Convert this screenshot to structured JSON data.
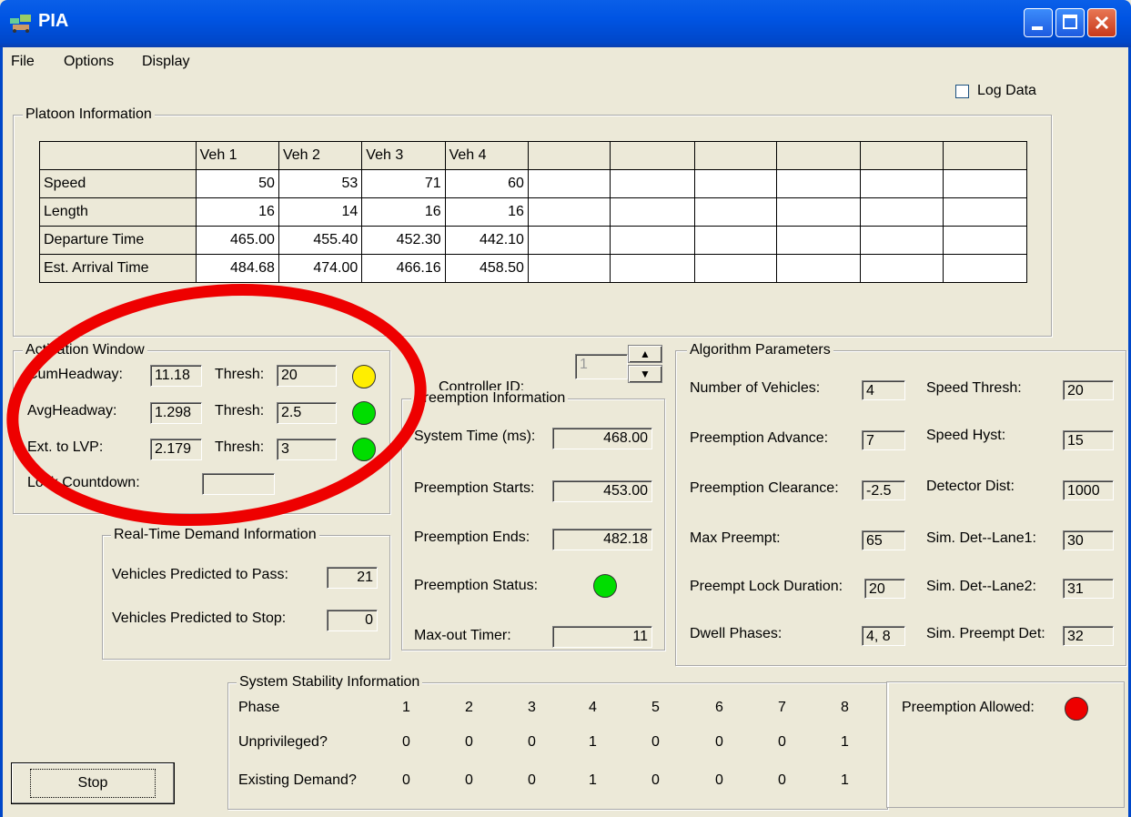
{
  "window": {
    "title": "PIA"
  },
  "menu": [
    "File",
    "Options",
    "Display"
  ],
  "log_data": {
    "label": "Log Data",
    "checked": false
  },
  "platoon": {
    "legend": "Platoon Information",
    "columns": [
      "",
      "Veh 1",
      "Veh 2",
      "Veh 3",
      "Veh 4",
      "",
      "",
      "",
      "",
      "",
      ""
    ],
    "rows": [
      {
        "label": "Speed",
        "values": [
          "50",
          "53",
          "71",
          "60"
        ]
      },
      {
        "label": "Length",
        "values": [
          "16",
          "14",
          "16",
          "16"
        ]
      },
      {
        "label": "Departure Time",
        "values": [
          "465.00",
          "455.40",
          "452.30",
          "442.10"
        ]
      },
      {
        "label": "Est. Arrival Time",
        "values": [
          "484.68",
          "474.00",
          "466.16",
          "458.50"
        ]
      }
    ]
  },
  "activation": {
    "legend": "Activation Window",
    "rows": [
      {
        "label": "CumHeadway:",
        "value": "11.18",
        "thresh_label": "Thresh:",
        "thresh": "20",
        "led": "#FFEE00"
      },
      {
        "label": "AvgHeadway:",
        "value": "1.298",
        "thresh_label": "Thresh:",
        "thresh": "2.5",
        "led": "#00DD00"
      },
      {
        "label": "Ext. to LVP:",
        "value": "2.179",
        "thresh_label": "Thresh:",
        "thresh": "3",
        "led": "#00DD00"
      }
    ],
    "lock_label": "Lock Countdown:",
    "lock_value": ""
  },
  "controller": {
    "label": "Controller ID:",
    "value": "1"
  },
  "preemption": {
    "legend": "Preemption Information",
    "system_time_label": "System Time (ms):",
    "system_time": "468.00",
    "starts_label": "Preemption Starts:",
    "starts": "453.00",
    "ends_label": "Preemption Ends:",
    "ends": "482.18",
    "status_label": "Preemption Status:",
    "status_color": "#00DD00",
    "maxout_label": "Max-out Timer:",
    "maxout": "11"
  },
  "demand": {
    "legend": "Real-Time Demand Information",
    "pass_label": "Vehicles Predicted to Pass:",
    "pass": "21",
    "stop_label": "Vehicles Predicted to Stop:",
    "stop": "0"
  },
  "algorithm": {
    "legend": "Algorithm Parameters",
    "left": [
      {
        "label": "Number of Vehicles:",
        "value": "4"
      },
      {
        "label": "Preemption Advance:",
        "value": "7"
      },
      {
        "label": "Preemption Clearance:",
        "value": "-2.5"
      },
      {
        "label": "Max Preempt:",
        "value": "65"
      },
      {
        "label": "Preempt Lock Duration:",
        "value": "20"
      },
      {
        "label": "Dwell Phases:",
        "value": "4, 8"
      }
    ],
    "right": [
      {
        "label": "Speed Thresh:",
        "value": "20"
      },
      {
        "label": "Speed Hyst:",
        "value": "15"
      },
      {
        "label": "Detector Dist:",
        "value": "1000"
      },
      {
        "label": "Sim. Det--Lane1:",
        "value": "30"
      },
      {
        "label": "Sim. Det--Lane2:",
        "value": "31"
      },
      {
        "label": "Sim. Preempt Det:",
        "value": "32"
      }
    ]
  },
  "stability": {
    "legend": "System Stability Information",
    "rows": [
      {
        "label": "Phase",
        "values": [
          "1",
          "2",
          "3",
          "4",
          "5",
          "6",
          "7",
          "8"
        ]
      },
      {
        "label": "Unprivileged?",
        "values": [
          "0",
          "0",
          "0",
          "1",
          "0",
          "0",
          "0",
          "1"
        ]
      },
      {
        "label": "Existing Demand?",
        "values": [
          "0",
          "0",
          "0",
          "1",
          "0",
          "0",
          "0",
          "1"
        ]
      }
    ]
  },
  "preemption_allowed": {
    "label": "Preemption Allowed:",
    "color": "#EE0000"
  },
  "stop_button": "Stop",
  "annotation": {
    "color": "#EE0000"
  }
}
